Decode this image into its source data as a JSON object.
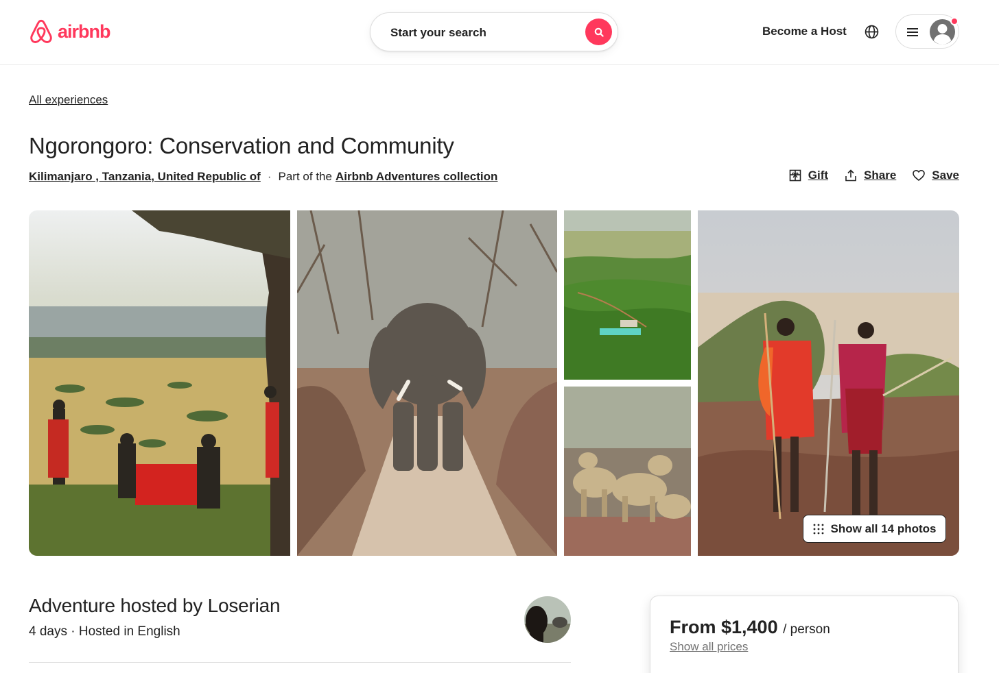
{
  "header": {
    "logo_text": "airbnb",
    "search_placeholder": "Start your search",
    "become_host": "Become a Host",
    "brand_color": "#ff385c"
  },
  "nav": {
    "back_link": "All experiences"
  },
  "listing": {
    "title": "Ngorongoro: Conservation and Community",
    "location": "Kilimanjaro , Tanzania, United Republic of",
    "part_of_prefix": "Part of the",
    "collection": "Airbnb Adventures collection",
    "actions": {
      "gift": "Gift",
      "share": "Share",
      "save": "Save"
    }
  },
  "gallery": {
    "show_all": "Show all 14 photos",
    "photos": [
      "safari-dinner-photo",
      "elephant-photo",
      "aerial-lodge-photo",
      "lions-photo",
      "maasai-warriors-photo"
    ]
  },
  "host": {
    "title": "Adventure hosted by Loserian",
    "subtitle": "4 days · Hosted in English"
  },
  "booking": {
    "price": "From $1,400",
    "per": "/ person",
    "show_prices": "Show all prices"
  }
}
